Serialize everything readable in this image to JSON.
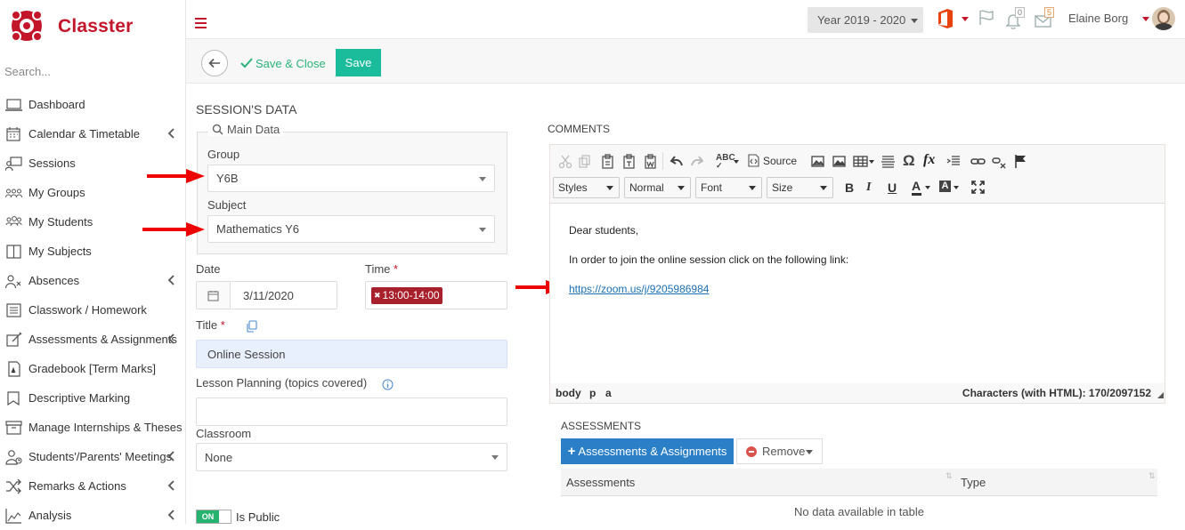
{
  "app": {
    "name": "Classter"
  },
  "sidebar": {
    "search_placeholder": "Search...",
    "items": [
      {
        "label": "Dashboard",
        "has_submenu": false
      },
      {
        "label": "Calendar & Timetable",
        "has_submenu": true
      },
      {
        "label": "Sessions",
        "has_submenu": false
      },
      {
        "label": "My Groups",
        "has_submenu": false
      },
      {
        "label": "My Students",
        "has_submenu": false
      },
      {
        "label": "My Subjects",
        "has_submenu": false
      },
      {
        "label": "Absences",
        "has_submenu": true
      },
      {
        "label": "Classwork / Homework",
        "has_submenu": false
      },
      {
        "label": "Assessments & Assignments",
        "has_submenu": true
      },
      {
        "label": "Gradebook [Term Marks]",
        "has_submenu": false
      },
      {
        "label": "Descriptive Marking",
        "has_submenu": false
      },
      {
        "label": "Manage Internships & Theses",
        "has_submenu": false
      },
      {
        "label": "Students'/Parents' Meetings",
        "has_submenu": true
      },
      {
        "label": "Remarks & Actions",
        "has_submenu": true
      },
      {
        "label": "Analysis",
        "has_submenu": true
      }
    ]
  },
  "topbar": {
    "year": "Year 2019 - 2020",
    "notifications_count": "0",
    "messages_count": "5",
    "user_name": "Elaine Borg"
  },
  "actions": {
    "save_close": "Save & Close",
    "save": "Save"
  },
  "form": {
    "section_title": "SESSION'S DATA",
    "main_data_legend": "Main Data",
    "group_label": "Group",
    "group_value": "Y6B",
    "subject_label": "Subject",
    "subject_value": "Mathematics Y6",
    "date_label": "Date",
    "date_value": "3/11/2020",
    "time_label": "Time",
    "time_value": "13:00-14:00",
    "title_label": "Title",
    "title_value": "Online Session",
    "lesson_planning_label": "Lesson Planning (topics covered)",
    "lesson_planning_value": "",
    "classroom_label": "Classroom",
    "classroom_value": "None",
    "is_public_toggle": "ON",
    "is_public_label": "Is Public"
  },
  "comments": {
    "title": "COMMENTS",
    "toolbar": {
      "source": "Source",
      "styles": "Styles",
      "format": "Normal",
      "font": "Font",
      "size": "Size"
    },
    "body_line1": "Dear students,",
    "body_line2": "In order to join the online session click on the following link:",
    "body_link": "https://zoom.us/j/9205986984",
    "path": [
      "body",
      "p",
      "a"
    ],
    "char_count": "Characters (with HTML): 170/2097152"
  },
  "assessments": {
    "title": "ASSESSMENTS",
    "add_button": "Assessments & Assignments",
    "remove_button": "Remove",
    "columns": [
      "Assessments",
      "Type"
    ],
    "empty_text": "No data available in table"
  },
  "colors": {
    "brand": "#c4162a",
    "save_green": "#1abc9c",
    "primary_blue": "#2a7fc7",
    "link": "#1a6fb5",
    "time_badge": "#a8202c",
    "toggle_green": "#26b36f"
  }
}
